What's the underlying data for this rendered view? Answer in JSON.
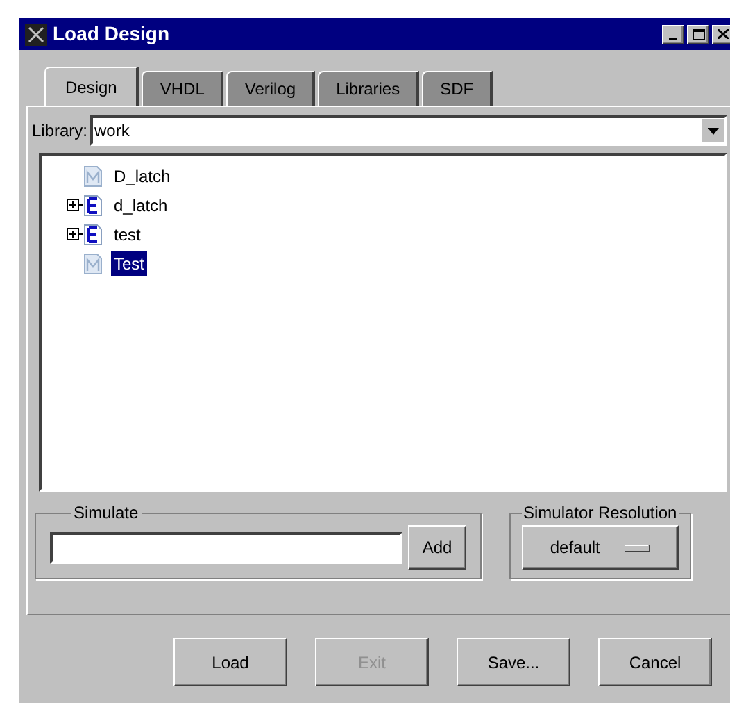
{
  "window": {
    "title": "Load Design"
  },
  "tabs": [
    {
      "label": "Design",
      "selected": true
    },
    {
      "label": "VHDL",
      "selected": false
    },
    {
      "label": "Verilog",
      "selected": false
    },
    {
      "label": "Libraries",
      "selected": false
    },
    {
      "label": "SDF",
      "selected": false
    }
  ],
  "library": {
    "label": "Library:",
    "value": "work"
  },
  "tree": [
    {
      "kind": "module",
      "label": "D_latch",
      "selected": false
    },
    {
      "kind": "entity",
      "label": "d_latch",
      "selected": false,
      "expanded": false
    },
    {
      "kind": "entity",
      "label": "test",
      "selected": false,
      "expanded": false
    },
    {
      "kind": "module",
      "label": "Test",
      "selected": true
    }
  ],
  "simulate": {
    "title": "Simulate",
    "add_button": "Add"
  },
  "resolution": {
    "title": "Simulator Resolution",
    "value": "default"
  },
  "buttons": [
    {
      "label": "Load",
      "disabled": false
    },
    {
      "label": "Exit",
      "disabled": true
    },
    {
      "label": "Save...",
      "disabled": false
    },
    {
      "label": "Cancel",
      "disabled": false
    }
  ]
}
